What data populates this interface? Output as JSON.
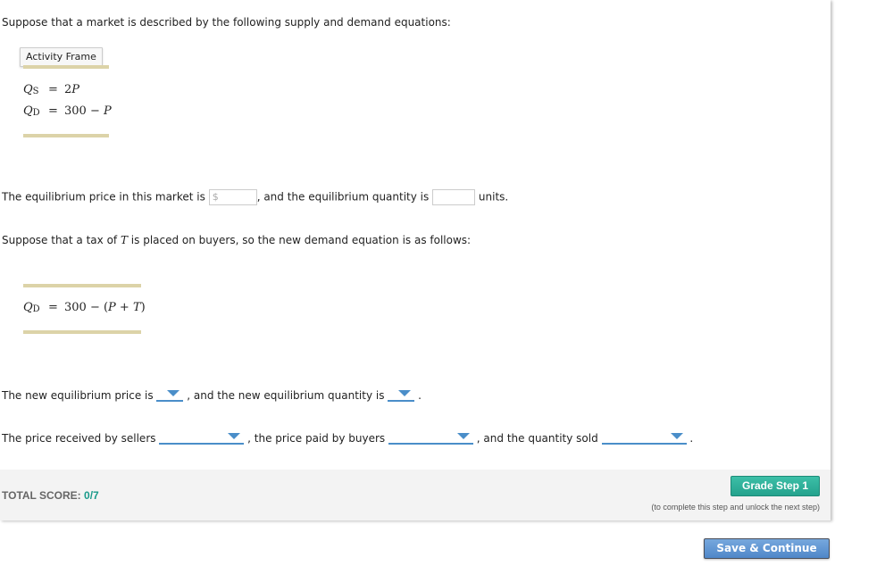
{
  "intro": {
    "text": "Suppose that a market is described by the following supply and demand equations:",
    "activity_frame_label": "Activity Frame"
  },
  "equations_1": [
    {
      "lhs": "Q",
      "sub": "S",
      "op": "=",
      "rhs_pre": "2",
      "rhs_var": "P",
      "rhs_post": ""
    },
    {
      "lhs": "Q",
      "sub": "D",
      "op": "=",
      "rhs_pre": "300 − ",
      "rhs_var": "P",
      "rhs_post": ""
    }
  ],
  "question_1": {
    "part1": "The equilibrium price in this market is",
    "price_prefix": "$",
    "price_value": "",
    "part2": ", and the equilibrium quantity is",
    "quantity_value": "",
    "part3": "units."
  },
  "tax_intro": {
    "pre": "Suppose that a tax of ",
    "var": "T",
    "post": " is placed on buyers, so the new demand equation is as follows:"
  },
  "equation_2": {
    "lhs": "Q",
    "sub": "D",
    "op": "=",
    "rhs": "300 − (",
    "p": "P",
    "plus": " + ",
    "t": "T",
    "close": ")"
  },
  "question_2": {
    "part1": "The new equilibrium price is",
    "price_selected": "",
    "part2": ", and the new equilibrium quantity is",
    "quantity_selected": "",
    "part3": "."
  },
  "question_3": {
    "part1": "The price received by sellers",
    "sellers_selected": "",
    "part2": ", the price paid by buyers",
    "buyers_selected": "",
    "part3": ", and the quantity sold",
    "quantity_selected": "",
    "part4": "."
  },
  "footer": {
    "score_label": "TOTAL SCORE:",
    "score_value": "0/7",
    "grade_button": "Grade Step 1",
    "grade_note": "(to complete this step and unlock the next step)"
  },
  "save_button": "Save & Continue",
  "colors": {
    "accent_blue": "#4a8ec9",
    "grade_green": "#24a28d",
    "score_teal": "#1a9a8a",
    "rule_tan": "#dcd3a8"
  }
}
